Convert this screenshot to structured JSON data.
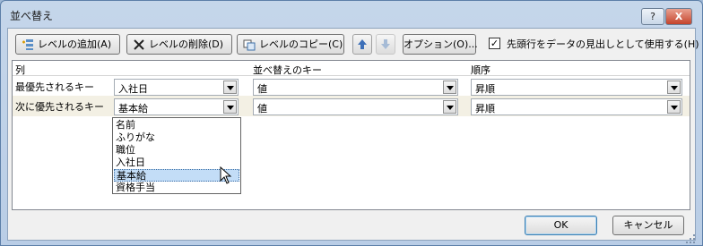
{
  "window": {
    "title": "並べ替え",
    "help_label": "?",
    "close_label": "X"
  },
  "toolbar": {
    "add_level": "レベルの追加(A)",
    "delete_level": "レベルの削除(D)",
    "copy_level": "レベルのコピー(C)",
    "options": "オプション(O)...",
    "header_checkbox_label": "先頭行をデータの見出しとして使用する(H)",
    "header_checkbox_checked": true,
    "header_checkbox_mark": "✓"
  },
  "grid": {
    "headers": {
      "column": "列",
      "sort_on": "並べ替えのキー",
      "order": "順序"
    },
    "rows": [
      {
        "label": "最優先されるキー",
        "column": "入社日",
        "sort_on": "値",
        "order": "昇順"
      },
      {
        "label": "次に優先されるキー",
        "column": "基本給",
        "sort_on": "値",
        "order": "昇順"
      }
    ]
  },
  "dropdown": {
    "items": [
      "名前",
      "ふりがな",
      "職位",
      "入社日",
      "基本給",
      "資格手当"
    ],
    "selected_index": 4
  },
  "footer": {
    "ok": "OK",
    "cancel": "キャンセル"
  },
  "colors": {
    "selection": "#c3ddf7",
    "row_highlight": "#f3f0e4",
    "title_bg": "#c5d6ea"
  }
}
